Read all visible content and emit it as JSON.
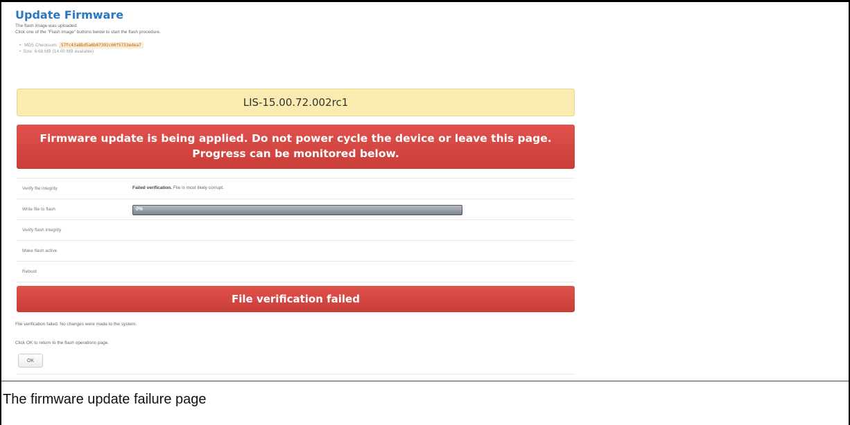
{
  "page": {
    "title": "Update Firmware",
    "intro_line1": "The flash image was uploaded.",
    "intro_line2": "Click one of the \"Flash Image\" buttons below to start the flash procedure."
  },
  "image_info": {
    "checksum_label": "MD5 Checksum:",
    "checksum_value": "57fc43a8bd5a6b07302c60f5733edea7",
    "size_text": "Size: 6.68 MB (14.00 MB available)"
  },
  "version": "LIS-15.00.72.002rc1",
  "warning": {
    "line1": "Firmware update is being applied. Do not power cycle the device or leave this page.",
    "line2": "Progress can be monitored below."
  },
  "steps": [
    {
      "label": "Verify file integrity",
      "status_bold": "Failed verification.",
      "status_text": " File is most likely corrupt."
    },
    {
      "label": "Write file to flash",
      "progress": 0,
      "progress_text": "0%"
    },
    {
      "label": "Verify flash integrity"
    },
    {
      "label": "Make flash active"
    },
    {
      "label": "Reboot"
    }
  ],
  "failure": {
    "banner": "File verification failed",
    "message": "File verification failed. No changes were made to the system.",
    "ok_hint": "Click OK to return to the flash operations page.",
    "ok_label": "OK"
  },
  "caption": "The firmware update failure page",
  "colors": {
    "title": "#2a78c2",
    "version_bg": "#faecb0",
    "alert_red": "#dc4b46"
  }
}
